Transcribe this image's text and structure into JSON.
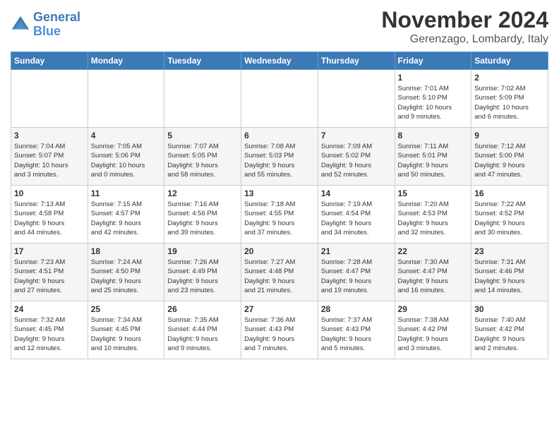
{
  "logo": {
    "line1": "General",
    "line2": "Blue"
  },
  "header": {
    "month": "November 2024",
    "location": "Gerenzago, Lombardy, Italy"
  },
  "weekdays": [
    "Sunday",
    "Monday",
    "Tuesday",
    "Wednesday",
    "Thursday",
    "Friday",
    "Saturday"
  ],
  "weeks": [
    [
      {
        "day": "",
        "info": ""
      },
      {
        "day": "",
        "info": ""
      },
      {
        "day": "",
        "info": ""
      },
      {
        "day": "",
        "info": ""
      },
      {
        "day": "",
        "info": ""
      },
      {
        "day": "1",
        "info": "Sunrise: 7:01 AM\nSunset: 5:10 PM\nDaylight: 10 hours\nand 9 minutes."
      },
      {
        "day": "2",
        "info": "Sunrise: 7:02 AM\nSunset: 5:09 PM\nDaylight: 10 hours\nand 6 minutes."
      }
    ],
    [
      {
        "day": "3",
        "info": "Sunrise: 7:04 AM\nSunset: 5:07 PM\nDaylight: 10 hours\nand 3 minutes."
      },
      {
        "day": "4",
        "info": "Sunrise: 7:05 AM\nSunset: 5:06 PM\nDaylight: 10 hours\nand 0 minutes."
      },
      {
        "day": "5",
        "info": "Sunrise: 7:07 AM\nSunset: 5:05 PM\nDaylight: 9 hours\nand 58 minutes."
      },
      {
        "day": "6",
        "info": "Sunrise: 7:08 AM\nSunset: 5:03 PM\nDaylight: 9 hours\nand 55 minutes."
      },
      {
        "day": "7",
        "info": "Sunrise: 7:09 AM\nSunset: 5:02 PM\nDaylight: 9 hours\nand 52 minutes."
      },
      {
        "day": "8",
        "info": "Sunrise: 7:11 AM\nSunset: 5:01 PM\nDaylight: 9 hours\nand 50 minutes."
      },
      {
        "day": "9",
        "info": "Sunrise: 7:12 AM\nSunset: 5:00 PM\nDaylight: 9 hours\nand 47 minutes."
      }
    ],
    [
      {
        "day": "10",
        "info": "Sunrise: 7:13 AM\nSunset: 4:58 PM\nDaylight: 9 hours\nand 44 minutes."
      },
      {
        "day": "11",
        "info": "Sunrise: 7:15 AM\nSunset: 4:57 PM\nDaylight: 9 hours\nand 42 minutes."
      },
      {
        "day": "12",
        "info": "Sunrise: 7:16 AM\nSunset: 4:56 PM\nDaylight: 9 hours\nand 39 minutes."
      },
      {
        "day": "13",
        "info": "Sunrise: 7:18 AM\nSunset: 4:55 PM\nDaylight: 9 hours\nand 37 minutes."
      },
      {
        "day": "14",
        "info": "Sunrise: 7:19 AM\nSunset: 4:54 PM\nDaylight: 9 hours\nand 34 minutes."
      },
      {
        "day": "15",
        "info": "Sunrise: 7:20 AM\nSunset: 4:53 PM\nDaylight: 9 hours\nand 32 minutes."
      },
      {
        "day": "16",
        "info": "Sunrise: 7:22 AM\nSunset: 4:52 PM\nDaylight: 9 hours\nand 30 minutes."
      }
    ],
    [
      {
        "day": "17",
        "info": "Sunrise: 7:23 AM\nSunset: 4:51 PM\nDaylight: 9 hours\nand 27 minutes."
      },
      {
        "day": "18",
        "info": "Sunrise: 7:24 AM\nSunset: 4:50 PM\nDaylight: 9 hours\nand 25 minutes."
      },
      {
        "day": "19",
        "info": "Sunrise: 7:26 AM\nSunset: 4:49 PM\nDaylight: 9 hours\nand 23 minutes."
      },
      {
        "day": "20",
        "info": "Sunrise: 7:27 AM\nSunset: 4:48 PM\nDaylight: 9 hours\nand 21 minutes."
      },
      {
        "day": "21",
        "info": "Sunrise: 7:28 AM\nSunset: 4:47 PM\nDaylight: 9 hours\nand 19 minutes."
      },
      {
        "day": "22",
        "info": "Sunrise: 7:30 AM\nSunset: 4:47 PM\nDaylight: 9 hours\nand 16 minutes."
      },
      {
        "day": "23",
        "info": "Sunrise: 7:31 AM\nSunset: 4:46 PM\nDaylight: 9 hours\nand 14 minutes."
      }
    ],
    [
      {
        "day": "24",
        "info": "Sunrise: 7:32 AM\nSunset: 4:45 PM\nDaylight: 9 hours\nand 12 minutes."
      },
      {
        "day": "25",
        "info": "Sunrise: 7:34 AM\nSunset: 4:45 PM\nDaylight: 9 hours\nand 10 minutes."
      },
      {
        "day": "26",
        "info": "Sunrise: 7:35 AM\nSunset: 4:44 PM\nDaylight: 9 hours\nand 9 minutes."
      },
      {
        "day": "27",
        "info": "Sunrise: 7:36 AM\nSunset: 4:43 PM\nDaylight: 9 hours\nand 7 minutes."
      },
      {
        "day": "28",
        "info": "Sunrise: 7:37 AM\nSunset: 4:43 PM\nDaylight: 9 hours\nand 5 minutes."
      },
      {
        "day": "29",
        "info": "Sunrise: 7:38 AM\nSunset: 4:42 PM\nDaylight: 9 hours\nand 3 minutes."
      },
      {
        "day": "30",
        "info": "Sunrise: 7:40 AM\nSunset: 4:42 PM\nDaylight: 9 hours\nand 2 minutes."
      }
    ]
  ]
}
